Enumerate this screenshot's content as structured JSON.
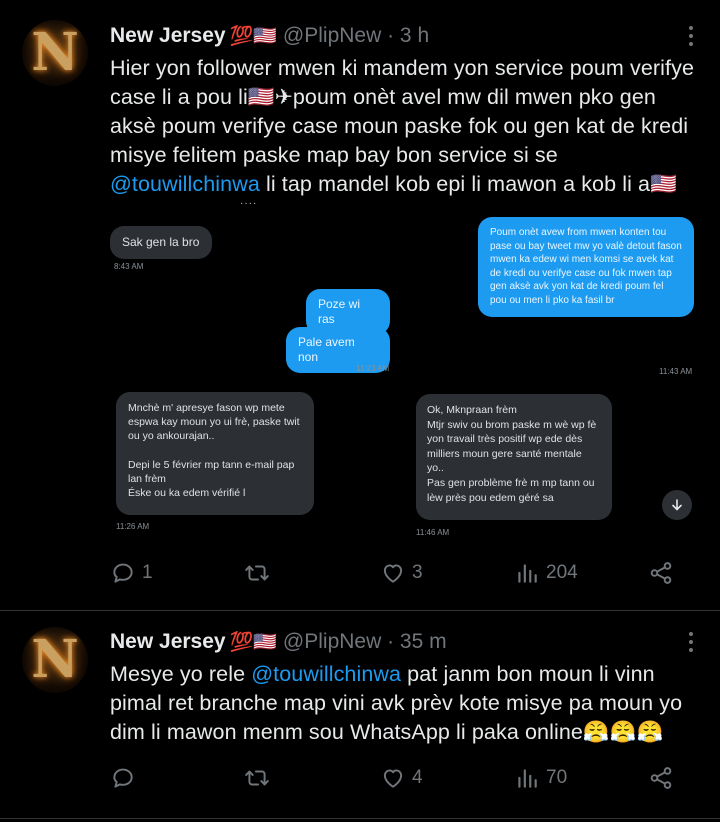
{
  "tweets": [
    {
      "avatar_letter": "N",
      "name": "New Jersey",
      "name_emoji": "💯🇺🇸",
      "handle_time": "@PlipNew · 3 h",
      "text_before_mention": "Hier yon follower mwen ki mandem yon service poum verifye case li a pou li🇺🇸✈poum onèt avel mw dil mwen pko gen aksè poum verifye case moun paske fok ou gen kat de kredi misye felitem paske map bay bon service si se ",
      "mention": "@touwillchinwa",
      "text_after_mention": " li tap mandel kob epi li mawon a kob li a🇺🇸",
      "screenshot": {
        "stray_mark": "····",
        "messages": [
          {
            "side": "received",
            "text": "Sak gen la bro",
            "time": "8:43 AM"
          },
          {
            "side": "sent",
            "text": "Poum onèt avew from mwen konten tou pase ou bay tweet mw yo valè detout fason mwen ka edew wi men komsi se avek kat de kredi ou verifye case ou fok mwen tap gen aksè avk yon kat de kredi poum fel pou ou men li pko ka fasil br",
            "time": "11:43 AM"
          },
          {
            "side": "sent",
            "text": "Poze wi ras",
            "time": ""
          },
          {
            "side": "sent",
            "text": "Pale avem non",
            "time": "11:23 AM"
          },
          {
            "side": "received",
            "text": "Mnchè m' apresye fason wp mete espwa kay moun yo ui frè, paske twit ou yo ankourajan..\n\nDepi le 5 février mp tann e-mail pap lan frèm\nÉske ou ka edem vérifié l",
            "time": "11:26 AM"
          },
          {
            "side": "received",
            "text": "Ok, Mknpraan frèm\nMtjr swiv ou brom paske m wè wp fè yon travail très positif wp ede dès milliers moun gere santé mentale yo..\nPas gen problème frè m mp tann ou lèw près pou edem géré sa",
            "time": "11:46 AM"
          }
        ]
      },
      "replies": "1",
      "retweets": "",
      "likes": "3",
      "views": "204"
    },
    {
      "avatar_letter": "N",
      "name": "New Jersey",
      "name_emoji": "💯🇺🇸",
      "handle_time": "@PlipNew · 35 m",
      "text_before_mention": "Mesye yo rele ",
      "mention": "@touwillchinwa",
      "text_after_mention": " pat janm bon moun li vinn pimal ret branche map vini avk prèv kote misye pa moun yo dim li mawon menm sou WhatsApp li paka online😤😤😤",
      "replies": "",
      "retweets": "",
      "likes": "4",
      "views": "70"
    }
  ],
  "colors": {
    "background": "#000000",
    "text": "#e7e9ea",
    "muted": "#71767b",
    "accent": "#1d9bf0",
    "bubble_grey": "#2c2f33"
  },
  "icons": [
    "more-icon",
    "reply-icon",
    "retweet-icon",
    "like-icon",
    "views-icon",
    "share-icon",
    "scroll-down-icon"
  ]
}
